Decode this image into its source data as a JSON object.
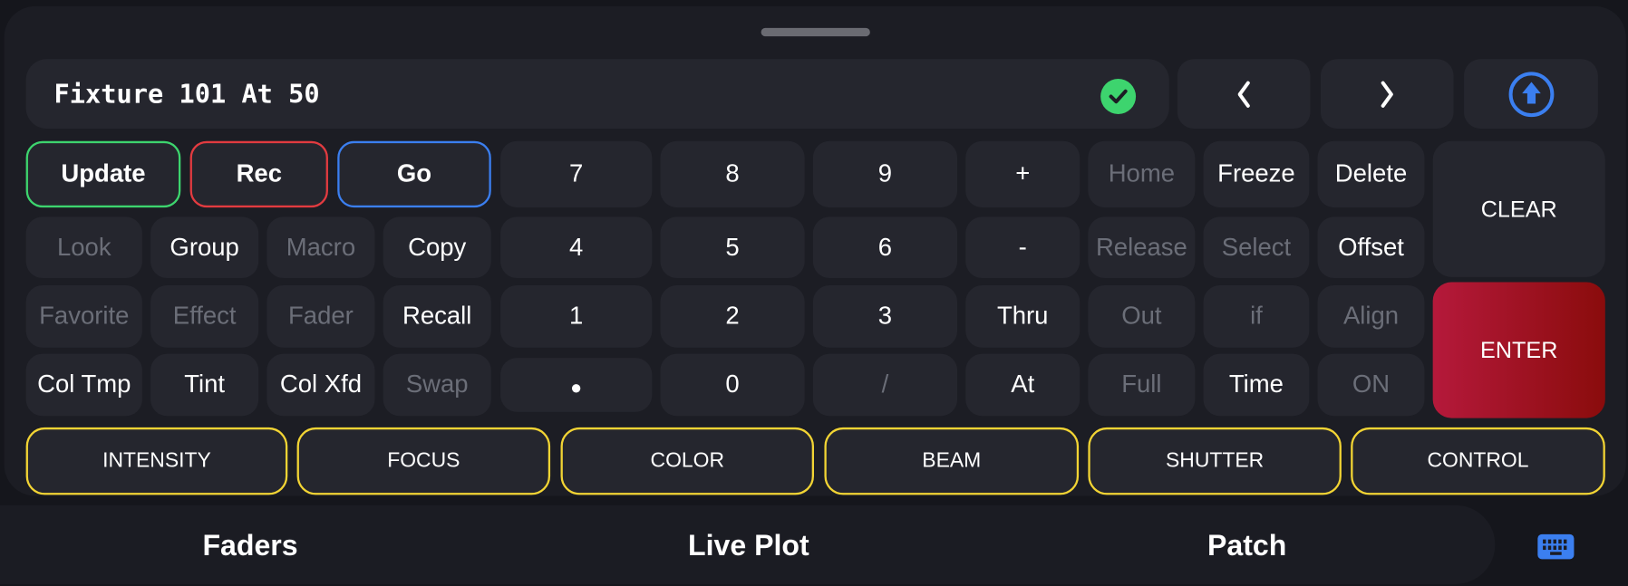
{
  "command_line": {
    "text": "Fixture 101 At 50",
    "status_icon": "check-circle-icon",
    "status_color": "#3dd46e"
  },
  "nav_buttons": [
    {
      "icon": "chevron-left-icon",
      "glyph": "‹"
    },
    {
      "icon": "chevron-right-icon",
      "glyph": "›"
    },
    {
      "icon": "arrow-up-circle-icon",
      "color": "#3b7ff0"
    }
  ],
  "actions": {
    "update": "Update",
    "rec": "Rec",
    "go": "Go"
  },
  "accent_colors": {
    "update": "#3dd46e",
    "rec": "#e23b40",
    "go": "#3b7ff0",
    "category": "#f2d434",
    "enter": "#b5193b"
  },
  "keys": {
    "row2_left": [
      "Look",
      "Group",
      "Macro",
      "Copy"
    ],
    "row3_left": [
      "Favorite",
      "Effect",
      "Fader",
      "Recall"
    ],
    "row4_left": [
      "Col Tmp",
      "Tint",
      "Col Xfd",
      "Swap"
    ],
    "numpad": [
      [
        "7",
        "8",
        "9",
        "+"
      ],
      [
        "4",
        "5",
        "6",
        "-"
      ],
      [
        "1",
        "2",
        "3",
        "Thru"
      ],
      [
        "•",
        "0",
        "/",
        "At"
      ]
    ],
    "right": [
      [
        "Home",
        "Freeze",
        "Delete"
      ],
      [
        "Release",
        "Select",
        "Offset"
      ],
      [
        "Out",
        "if",
        "Align"
      ],
      [
        "Full",
        "Time",
        "ON"
      ]
    ],
    "clear": "CLEAR",
    "enter": "ENTER"
  },
  "categories": [
    "INTENSITY",
    "FOCUS",
    "COLOR",
    "BEAM",
    "SHUTTER",
    "CONTROL"
  ],
  "bottom_tabs": [
    "Faders",
    "Live Plot",
    "Patch"
  ],
  "keyboard_icon": "keyboard-icon"
}
